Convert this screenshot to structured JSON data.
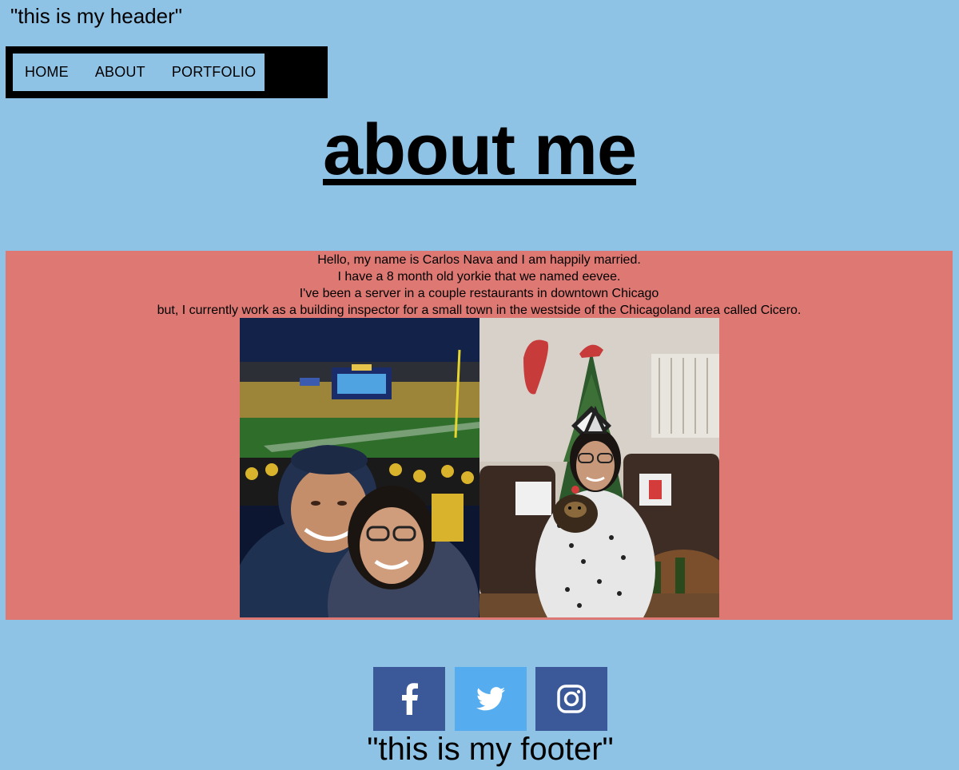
{
  "header": {
    "text": "\"this is my header\""
  },
  "nav": {
    "items": [
      {
        "label": "HOME"
      },
      {
        "label": "ABOUT"
      },
      {
        "label": "PORTFOLIO"
      }
    ]
  },
  "main": {
    "title": "about me",
    "lines": [
      "Hello, my name is Carlos Nava and I am happily married.",
      "I have a 8 month old yorkie that we named eevee.",
      "I've been a server in a couple restaurants in downtown Chicago",
      "but, I currently work as a building inspector for a small town in the westside of the Chicagoland area called Cicero."
    ]
  },
  "social": [
    {
      "icon": "facebook-icon",
      "color": "#3b5998"
    },
    {
      "icon": "twitter-icon",
      "color": "#55acee"
    },
    {
      "icon": "instagram-icon",
      "color": "#3b5998"
    }
  ],
  "footer": {
    "text": "\"this is my footer\""
  },
  "colors": {
    "page_background": "#8fc3e6",
    "about_background": "#dd7873",
    "nav_frame": "#000000"
  }
}
